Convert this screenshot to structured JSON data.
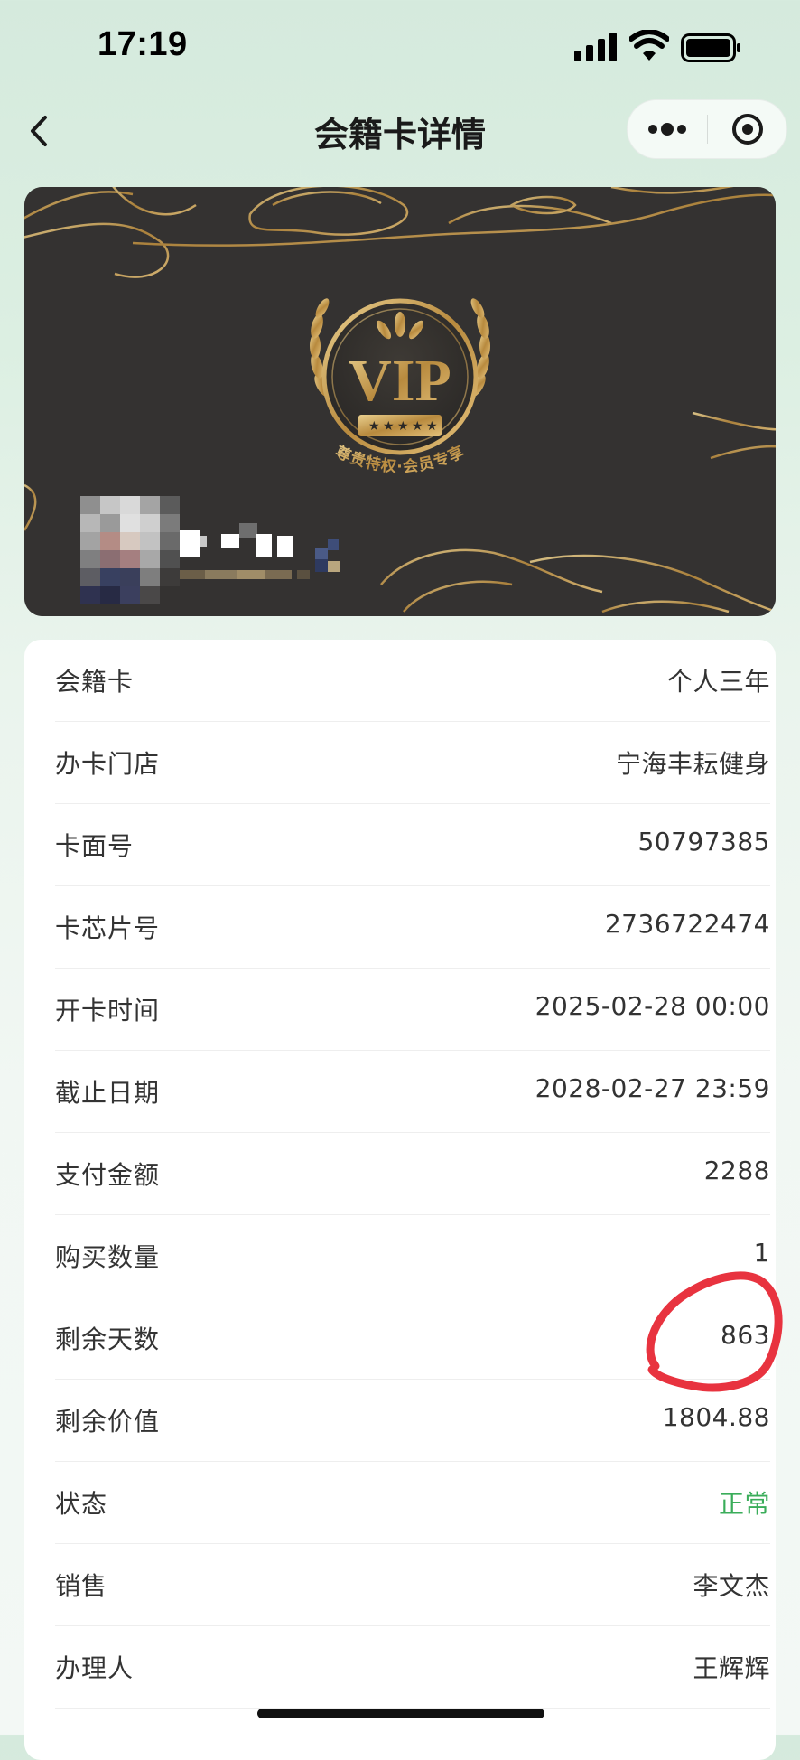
{
  "status_bar": {
    "time": "17:19"
  },
  "nav": {
    "title": "会籍卡详情",
    "icons": [
      "back-chevron-icon",
      "more-dots-icon",
      "close-target-icon"
    ]
  },
  "vip_card": {
    "badge_text": "VIP",
    "slogan": "尊贵特权·会员专享",
    "colors": {
      "background": "#343231",
      "gold": "#c9a45c"
    }
  },
  "details": [
    {
      "label": "会籍卡",
      "value": "个人三年"
    },
    {
      "label": "办卡门店",
      "value": "宁海丰耘健身"
    },
    {
      "label": "卡面号",
      "value": "50797385"
    },
    {
      "label": "卡芯片号",
      "value": "2736722474"
    },
    {
      "label": "开卡时间",
      "value": "2025-02-28 00:00"
    },
    {
      "label": "截止日期",
      "value": "2028-02-27 23:59"
    },
    {
      "label": "支付金额",
      "value": "2288"
    },
    {
      "label": "购买数量",
      "value": "1"
    },
    {
      "label": "剩余天数",
      "value": "863"
    },
    {
      "label": "剩余价值",
      "value": "1804.88"
    },
    {
      "label": "状态",
      "value": "正常"
    },
    {
      "label": "销售",
      "value": "李文杰"
    },
    {
      "label": "办理人",
      "value": "王辉辉"
    }
  ],
  "colors": {
    "status_ok": "#3aad5a",
    "annotation_red": "#e8333f"
  }
}
